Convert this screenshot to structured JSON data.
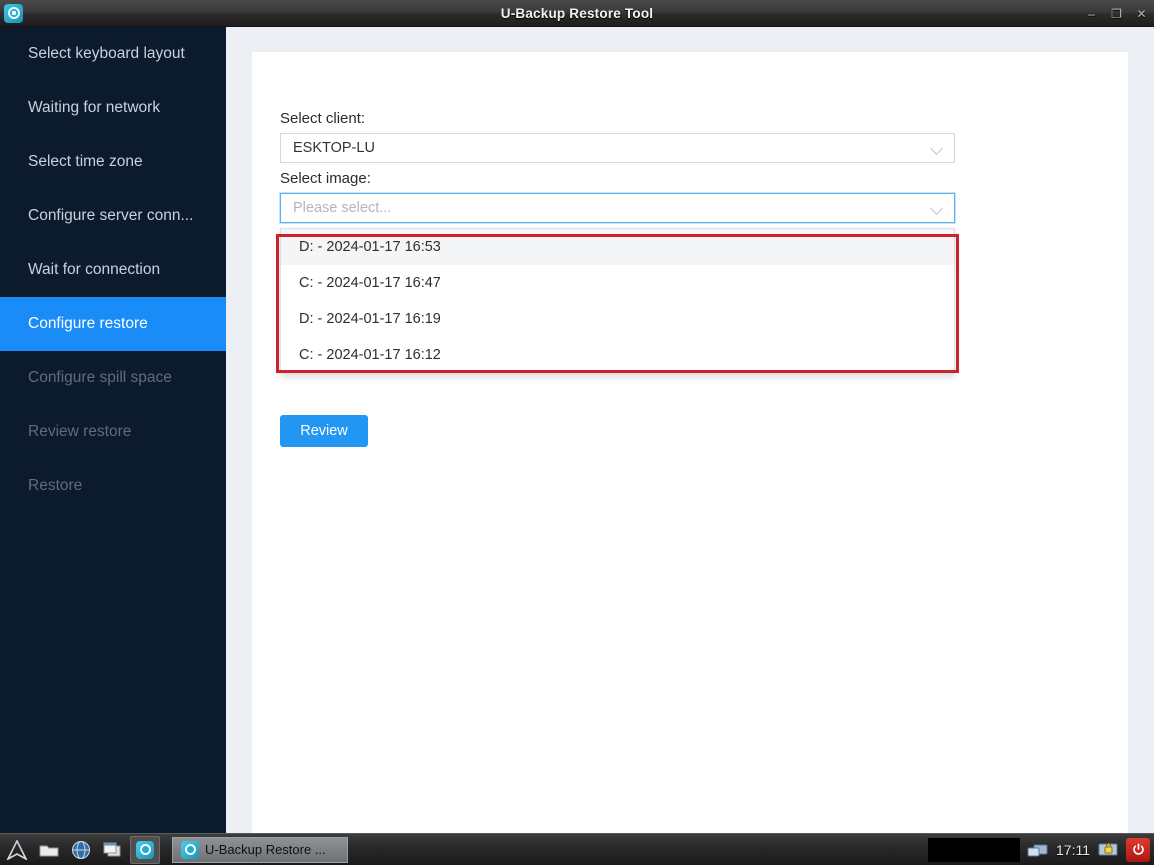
{
  "window": {
    "title": "U-Backup Restore Tool",
    "app_icon": "backup-app-icon",
    "controls": {
      "minimize": "–",
      "maximize": "❐",
      "close": "✕"
    }
  },
  "sidebar": {
    "items": [
      {
        "label": "Select keyboard layout",
        "state": "done"
      },
      {
        "label": "Waiting for network",
        "state": "done"
      },
      {
        "label": "Select time zone",
        "state": "done"
      },
      {
        "label": "Configure server conn...",
        "state": "done"
      },
      {
        "label": "Wait for connection",
        "state": "done"
      },
      {
        "label": "Configure restore",
        "state": "active"
      },
      {
        "label": "Configure spill space",
        "state": "disabled"
      },
      {
        "label": "Review restore",
        "state": "disabled"
      },
      {
        "label": "Restore",
        "state": "disabled"
      }
    ]
  },
  "main": {
    "client_label": "Select client:",
    "client_value": "ESKTOP-LU",
    "image_label": "Select image:",
    "image_placeholder": "Please select...",
    "dropdown_options": [
      "D: - 2024-01-17 16:53",
      "C: - 2024-01-17 16:47",
      "D: - 2024-01-17 16:19",
      "C: - 2024-01-17 16:12"
    ],
    "dropdown_hovered_index": 0,
    "review_label": "Review"
  },
  "annotation": {
    "color": "#cc2229"
  },
  "taskbar": {
    "launchers": [
      "arch-logo-icon",
      "file-manager-icon",
      "web-browser-icon",
      "windows-icon",
      "backup-app-icon"
    ],
    "selected_launcher_index": 4,
    "window_button_label": "U-Backup Restore ...",
    "clock": "17:11",
    "tray": [
      "network-display-icon",
      "lock-screen-icon",
      "power-icon"
    ]
  },
  "colors": {
    "sidebar_bg": "#0c1a2e",
    "sidebar_active": "#1a8cf8",
    "accent": "#2196f3",
    "content_bg": "#eceff3",
    "annotation_red": "#cc2229"
  }
}
